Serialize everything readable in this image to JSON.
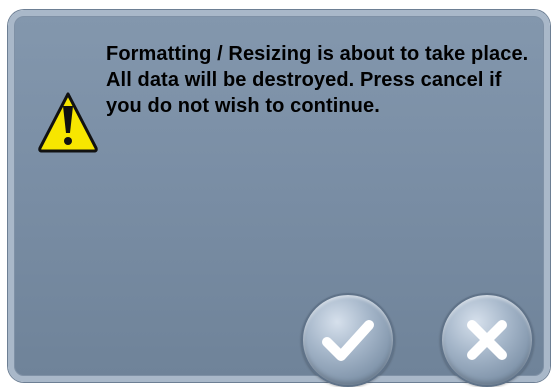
{
  "dialog": {
    "message": "Formatting / Resizing is about to take place. All data will be destroyed. Press cancel if you do not wish to continue.",
    "icon": "warning-icon"
  },
  "buttons": {
    "ok_icon": "checkmark-icon",
    "cancel_icon": "close-icon"
  },
  "colors": {
    "dialog_bg": "#7a8ea5",
    "dialog_border": "#a9b8c9",
    "warning_yellow": "#f7e600"
  }
}
